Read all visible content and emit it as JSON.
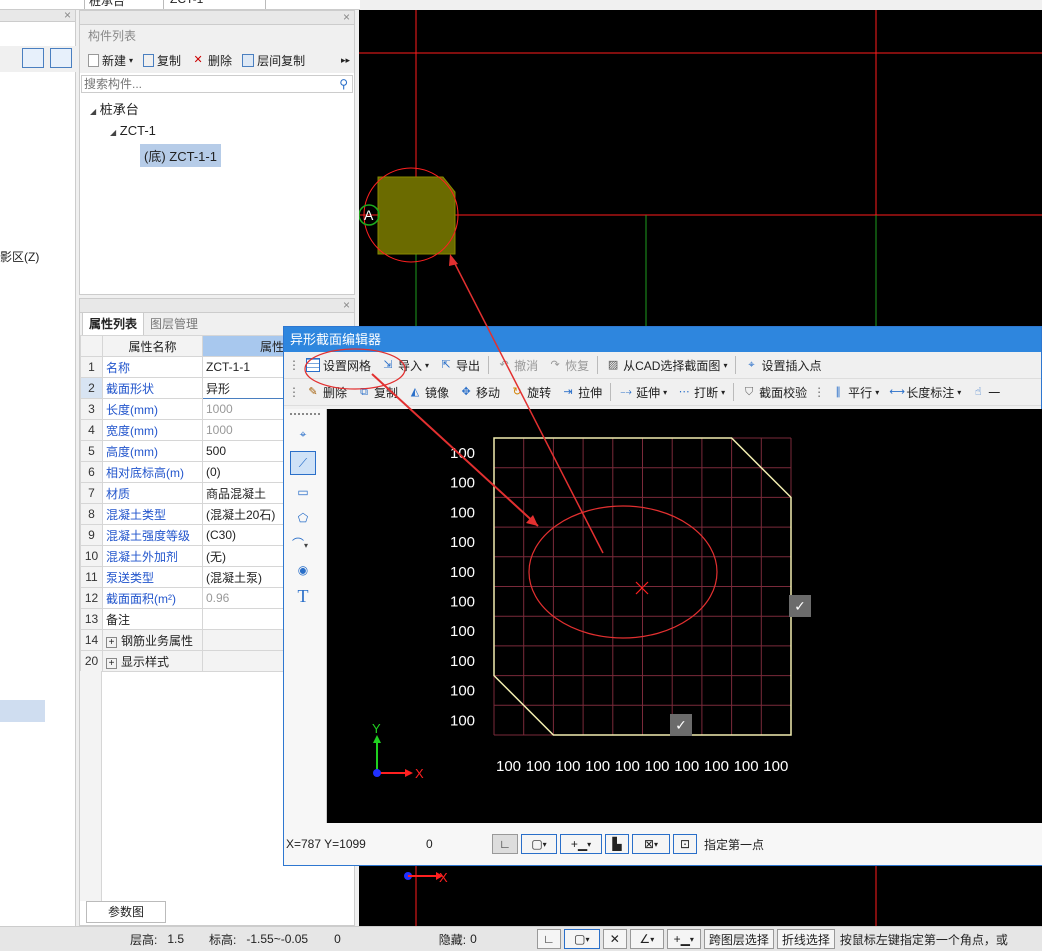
{
  "top_strip": {
    "cell1": "桩承台",
    "cell2": "ZCT-1"
  },
  "left_panel": {
    "partial_label": "影区(Z)"
  },
  "component_list": {
    "title": "构件列表",
    "toolbar": {
      "new": "新建",
      "copy": "复制",
      "delete": "删除",
      "floor_copy": "层间复制"
    },
    "search_placeholder": "搜索构件...",
    "tree": {
      "root": "桩承台",
      "child": "ZCT-1",
      "leaf": "(底) ZCT-1-1"
    }
  },
  "properties": {
    "tab_props": "属性列表",
    "tab_layers": "图层管理",
    "header_name": "属性名称",
    "header_value": "属性值",
    "rows": [
      {
        "num": "1",
        "name": "名称",
        "value": "ZCT-1-1"
      },
      {
        "num": "2",
        "name": "截面形状",
        "value": "异形"
      },
      {
        "num": "3",
        "name": "长度(mm)",
        "value": "1000"
      },
      {
        "num": "4",
        "name": "宽度(mm)",
        "value": "1000"
      },
      {
        "num": "5",
        "name": "高度(mm)",
        "value": "500"
      },
      {
        "num": "6",
        "name": "相对底标高(m)",
        "value": "(0)"
      },
      {
        "num": "7",
        "name": "材质",
        "value": "商品混凝土"
      },
      {
        "num": "8",
        "name": "混凝土类型",
        "value": "(混凝土20石)"
      },
      {
        "num": "9",
        "name": "混凝土强度等级",
        "value": "(C30)"
      },
      {
        "num": "10",
        "name": "混凝土外加剂",
        "value": "(无)"
      },
      {
        "num": "11",
        "name": "泵送类型",
        "value": "(混凝土泵)"
      },
      {
        "num": "12",
        "name": "截面面积(m²)",
        "value": "0.96"
      },
      {
        "num": "13",
        "name": "备注",
        "value": ""
      },
      {
        "num": "14",
        "name": "钢筋业务属性",
        "value": ""
      },
      {
        "num": "20",
        "name": "显示样式",
        "value": ""
      }
    ],
    "param_button": "参数图"
  },
  "canvas": {
    "axis_label": "A",
    "x_label": "X"
  },
  "editor": {
    "title": "异形截面编辑器",
    "toolbar1": {
      "grid": "设置网格",
      "import": "导入",
      "export": "导出",
      "undo": "撤消",
      "redo": "恢复",
      "cad_select": "从CAD选择截面图",
      "insert_point": "设置插入点"
    },
    "toolbar2": {
      "delete": "删除",
      "copy": "复制",
      "mirror": "镜像",
      "move": "移动",
      "rotate": "旋转",
      "stretch": "拉伸",
      "extend": "延伸",
      "break": "打断",
      "verify": "截面校验",
      "parallel": "平行",
      "dim": "长度标注",
      "more": "一"
    },
    "grid_rows": [
      "100",
      "100",
      "100",
      "100",
      "100",
      "100",
      "100",
      "100",
      "100",
      "100"
    ],
    "grid_cols": [
      "100",
      "100",
      "100",
      "100",
      "100",
      "100",
      "100",
      "100",
      "100",
      "100"
    ],
    "axis_y": "Y",
    "axis_x": "X",
    "status": {
      "coords": "X=787 Y=1099",
      "zero": "0",
      "hint": "指定第一点"
    }
  },
  "statusbar": {
    "floor_height": "层高:",
    "floor_height_val": "1.5",
    "elev": "标高:",
    "elev_val": "-1.55~-0.05",
    "zero": "0",
    "hidden": "隐藏:",
    "hidden_val": "0",
    "cross_floor": "跨图层选择",
    "polyline": "折线选择",
    "hint": "按鼠标左键指定第一个角点，或"
  }
}
